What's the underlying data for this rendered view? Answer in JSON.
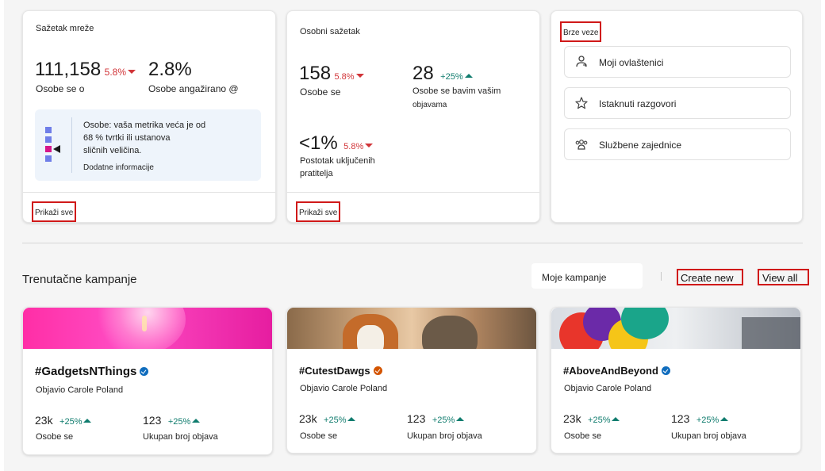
{
  "network_summary": {
    "title": "Sažetak mreže",
    "metric1": {
      "value": "111,158",
      "change": "5.8%",
      "label": "Osobe se o"
    },
    "metric2": {
      "value": "2.8%",
      "label": "Osobe angažirano @"
    },
    "info": {
      "text1": "Osobe: vaša metrika veća je od",
      "text2": "68 % tvrtki ili ustanova",
      "text3": "sličnih veličina.",
      "link": "Dodatne informacije"
    },
    "show_all": "Prikaži sve"
  },
  "personal_summary": {
    "title": "Osobni sažetak",
    "metric1": {
      "value": "158",
      "change": "5.8%",
      "label": "Osobe se"
    },
    "metric2": {
      "value": "28",
      "change": "+25%",
      "label1": "Osobe se bavim vašim",
      "label2": "objavama"
    },
    "metric3": {
      "value": "<1%",
      "change": "5.8%",
      "label1": "Postotak uključenih",
      "label2": "pratitelja"
    },
    "show_all": "Prikaži sve"
  },
  "quick_links": {
    "title": "Brze veze",
    "items": [
      {
        "label": "Moji ovlaštenici",
        "icon": "delegate-icon"
      },
      {
        "label": "Istaknuti razgovori",
        "icon": "star-icon"
      },
      {
        "label": "Službene zajednice",
        "icon": "community-icon"
      }
    ]
  },
  "campaigns": {
    "title": "Trenutačne kampanje",
    "filter": "Moje kampanje",
    "create_new": "Create new",
    "view_all": "View all",
    "cards": [
      {
        "title": "#GadgetsNThings",
        "author": "Objavio Carole Poland",
        "badge_color": "#0f6cbd",
        "m1": {
          "value": "23k",
          "change": "+25%",
          "label": "Osobe se"
        },
        "m2": {
          "value": "123",
          "change": "+25%",
          "label": "Ukupan broj objava"
        }
      },
      {
        "title": "#CutestDawgs",
        "author": "Objavio Carole Poland",
        "badge_color": "#d35400",
        "m1": {
          "value": "23k",
          "change": "+25%",
          "label": "Osobe se"
        },
        "m2": {
          "value": "123",
          "change": "+25%",
          "label": "Ukupan broj objava"
        }
      },
      {
        "title": "#AboveAndBeyond",
        "author": "Objavio Carole Poland",
        "badge_color": "#0f6cbd",
        "m1": {
          "value": "23k",
          "change": "+25%",
          "label": "Osobe se"
        },
        "m2": {
          "value": "123",
          "change": "+25%",
          "label": "Ukupan broj objava"
        }
      }
    ]
  }
}
